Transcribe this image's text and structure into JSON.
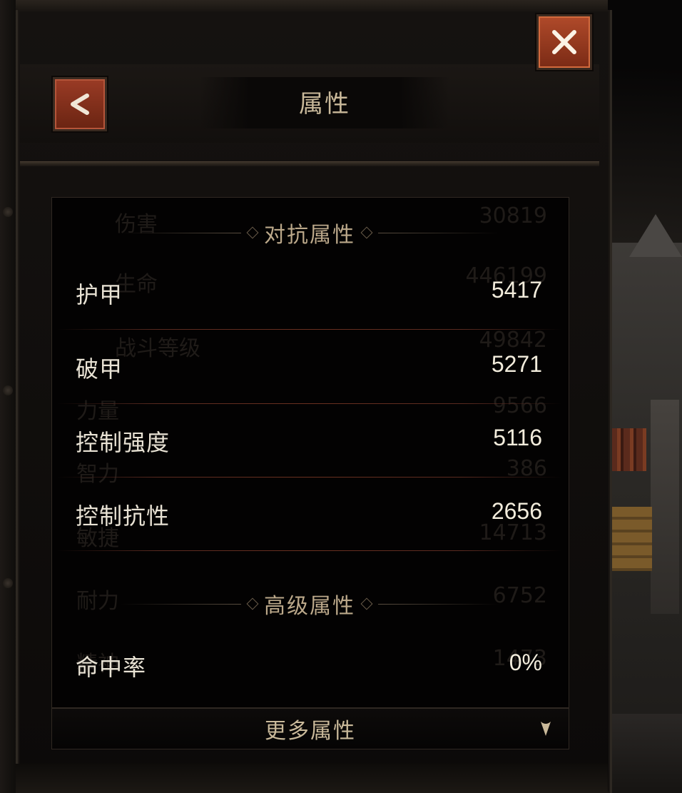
{
  "header": {
    "title": "属性"
  },
  "buttons": {
    "close_icon": "close-icon",
    "back_icon": "back-chevron-icon"
  },
  "sections": {
    "resist": {
      "label": "对抗属性"
    },
    "advanced": {
      "label": "高级属性"
    }
  },
  "stats": [
    {
      "name": "护甲",
      "value": "5417"
    },
    {
      "name": "破甲",
      "value": "5271"
    },
    {
      "name": "控制强度",
      "value": "5116"
    },
    {
      "name": "控制抗性",
      "value": "2656"
    }
  ],
  "advanced_stats": [
    {
      "name": "命中率",
      "value": "0%"
    }
  ],
  "background_stats": [
    {
      "name": "伤害",
      "value": "30819"
    },
    {
      "name": "生命",
      "value": "446199"
    },
    {
      "name": "战斗等级",
      "value": "49842"
    },
    {
      "name": "力量",
      "value": "9566"
    },
    {
      "name": "智力",
      "value": "386"
    },
    {
      "name": "敏捷",
      "value": "14713"
    },
    {
      "name": "耐力",
      "value": "6752"
    },
    {
      "name": "精神",
      "value": "1473"
    }
  ],
  "footer": {
    "more_label": "更多属性"
  },
  "colors": {
    "accent": "#b04a2a",
    "text": "#e8e2d4",
    "gold": "#c9b99a"
  }
}
